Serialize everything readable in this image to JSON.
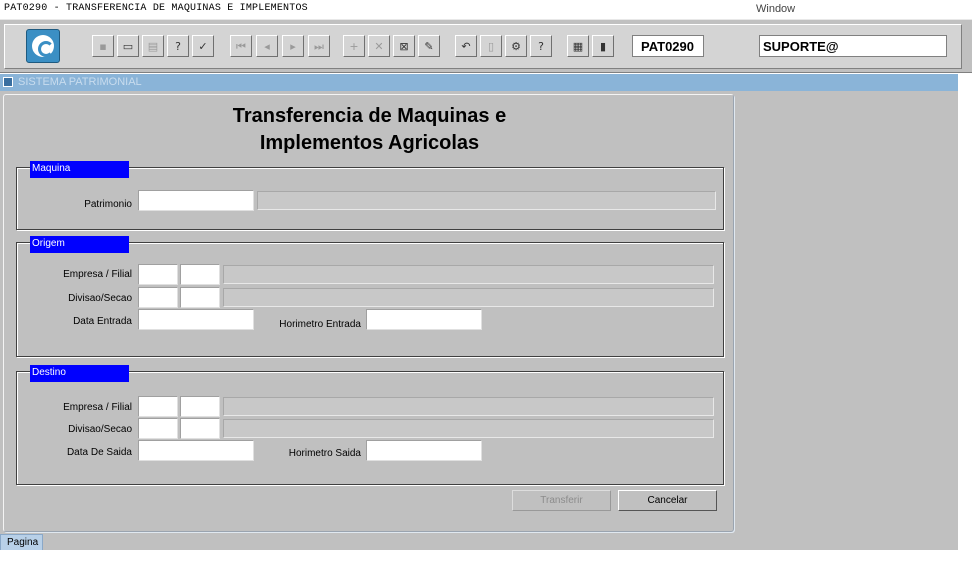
{
  "window": {
    "title": "PAT0290 - TRANSFERENCIA DE MAQUINAS E IMPLEMENTOS",
    "menu_label": "Window"
  },
  "toolbar": {
    "form_code": "PAT0290",
    "user": "SUPORTE@",
    "buttons": [
      {
        "name": "save-icon",
        "glyph": "▪",
        "enabled": false
      },
      {
        "name": "screen-icon",
        "glyph": "▭",
        "enabled": true
      },
      {
        "name": "print-icon",
        "glyph": "▤",
        "enabled": false
      },
      {
        "name": "query-icon",
        "glyph": "?",
        "enabled": true
      },
      {
        "name": "execute-query-icon",
        "glyph": "✓",
        "enabled": true
      },
      {
        "name": "first-record-icon",
        "glyph": "⏮",
        "enabled": false
      },
      {
        "name": "prev-record-icon",
        "glyph": "◂",
        "enabled": false
      },
      {
        "name": "next-record-icon",
        "glyph": "▸",
        "enabled": false
      },
      {
        "name": "last-record-icon",
        "glyph": "⏭",
        "enabled": false
      },
      {
        "name": "insert-record-icon",
        "glyph": "+",
        "enabled": false
      },
      {
        "name": "delete-record-icon",
        "glyph": "✕",
        "enabled": false
      },
      {
        "name": "clear-record-icon",
        "glyph": "⊠",
        "enabled": true
      },
      {
        "name": "edit-icon",
        "glyph": "✎",
        "enabled": true
      },
      {
        "name": "undo-icon",
        "glyph": "↶",
        "enabled": true
      },
      {
        "name": "clipboard-icon",
        "glyph": "▯",
        "enabled": false
      },
      {
        "name": "settings-icon",
        "glyph": "⚙",
        "enabled": true
      },
      {
        "name": "help-icon",
        "glyph": "?",
        "enabled": true
      },
      {
        "name": "news-icon",
        "glyph": "▦",
        "enabled": true
      },
      {
        "name": "exit-icon",
        "glyph": "▮",
        "enabled": true
      }
    ]
  },
  "system_bar": {
    "label": "SISTEMA PATRIMONIAL"
  },
  "form": {
    "title_line1": "Transferencia de Maquinas e",
    "title_line2": "Implementos Agricolas",
    "maquina": {
      "title": "Maquina",
      "patrimonio_label": "Patrimonio",
      "patrimonio_value": ""
    },
    "origem": {
      "title": "Origem",
      "empresa_label": "Empresa / Filial",
      "divisao_label": "Divisao/Secao",
      "data_label": "Data Entrada",
      "horimetro_label": "Horimetro Entrada"
    },
    "destino": {
      "title": "Destino",
      "empresa_label": "Empresa / Filial",
      "divisao_label": "Divisao/Secao",
      "data_label": "Data De Saida",
      "horimetro_label": "Horimetro Saida"
    },
    "buttons": {
      "transferir": "Transferir",
      "cancelar": "Cancelar"
    }
  },
  "tabs": {
    "pagina": "Pagina"
  }
}
